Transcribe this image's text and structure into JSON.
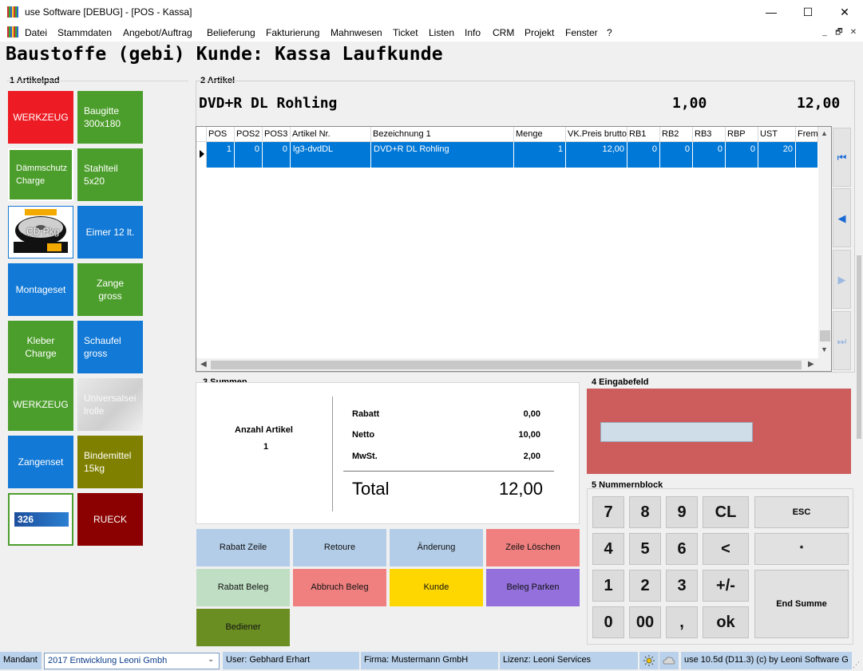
{
  "window": {
    "title": "use Software [DEBUG] - [POS - Kassa]",
    "min": "—",
    "max": "☐",
    "close": "✕"
  },
  "menu": [
    "Datei",
    "Stammdaten",
    "Angebot/Auftrag",
    "Belieferung",
    "Fakturierung",
    "Mahnwesen",
    "Ticket",
    "Listen",
    "Info",
    "CRM",
    "Projekt",
    "Fenster",
    "?"
  ],
  "mdi": [
    "_",
    "🗗",
    "✕"
  ],
  "header": {
    "title": "Baustoffe (gebi) Kunde: Kassa Laufkunde"
  },
  "artikelpad": {
    "label": "1 Artikelpad",
    "tiles": [
      {
        "label": "WERKZEUG",
        "color": "#ed1c24"
      },
      {
        "label": "Baugitte 300x180",
        "color": "#4c9e2c"
      },
      {
        "label": "Dämmschutz Charge",
        "color": "#4c9e2c"
      },
      {
        "label": "Stahlteil 5x20",
        "color": "#4c9e2c"
      },
      {
        "label": "CD Pkg",
        "color": "#ffffff"
      },
      {
        "label": "Eimer 12 lt.",
        "color": "#1279d6"
      },
      {
        "label": "Montageset",
        "color": "#1279d6"
      },
      {
        "label": "Zange gross",
        "color": "#4c9e2c"
      },
      {
        "label": "Kleber Charge",
        "color": "#4c9e2c"
      },
      {
        "label": "Schaufel gross",
        "color": "#1279d6"
      },
      {
        "label": "WERKZEUG",
        "color": "#4c9e2c"
      },
      {
        "label": "Universalseilrolle",
        "color": "#d7d7d7"
      },
      {
        "label": "Zangenset",
        "color": "#1279d6"
      },
      {
        "label": "Bindemittel 15kg",
        "color": "#808000"
      },
      {
        "label": "326",
        "color": "#ffffff"
      },
      {
        "label": "RUECK",
        "color": "#8b0000"
      }
    ]
  },
  "artikel": {
    "label": "2 Artikel",
    "name": "DVD+R DL Rohling",
    "qty": "1,00",
    "price": "12,00",
    "columns": [
      "POS",
      "POS2",
      "POS3",
      "Artikel Nr.",
      "Bezeichnung 1",
      "Menge",
      "VK.Preis brutto",
      "RB1",
      "RB2",
      "RB3",
      "RBP",
      "UST",
      "Frem"
    ],
    "rows": [
      [
        "1",
        "0",
        "0",
        "lg3-dvdDL",
        "DVD+R DL Rohling",
        "1",
        "12,00",
        "0",
        "0",
        "0",
        "0",
        "20",
        ""
      ]
    ],
    "nav": [
      "⏮",
      "◀",
      "▶",
      "⏭"
    ]
  },
  "summen": {
    "label": "3 Summen",
    "anzahl_label": "Anzahl Artikel",
    "anzahl_value": "1",
    "rabatt_label": "Rabatt",
    "rabatt_value": "0,00",
    "netto_label": "Netto",
    "netto_value": "10,00",
    "mwst_label": "MwSt.",
    "mwst_value": "2,00",
    "total_label": "Total",
    "total_value": "12,00"
  },
  "eingabe": {
    "label": "4 Eingabefeld",
    "value": ""
  },
  "nummernblock": {
    "label": "5 Nummernblock",
    "keys": [
      "7",
      "8",
      "9",
      "CL",
      "4",
      "5",
      "6",
      "<",
      "1",
      "2",
      "3",
      "+/-",
      "0",
      "00",
      ",",
      "ok"
    ],
    "esc": "ESC",
    "star": "*",
    "end": "End Summe"
  },
  "actions": [
    {
      "label": "Rabatt Zeile",
      "color": "#b3cde8"
    },
    {
      "label": "Retoure",
      "color": "#b3cde8"
    },
    {
      "label": "Änderung",
      "color": "#b3cde8"
    },
    {
      "label": "Zeile Löschen",
      "color": "#f08080"
    },
    {
      "label": "Rabatt Beleg",
      "color": "#bfdec3"
    },
    {
      "label": "Abbruch Beleg",
      "color": "#f08080"
    },
    {
      "label": "Kunde",
      "color": "#ffd700"
    },
    {
      "label": "Beleg Parken",
      "color": "#9370db"
    },
    {
      "label": "Bediener",
      "color": "#6b8e23"
    }
  ],
  "status": {
    "mandant_label": "Mandant",
    "mandant_value": "2017  Entwicklung Leoni Gmbh",
    "user": "User: Gebhard Erhart",
    "firma": "Firma: Mustermann GmbH",
    "lizenz": "Lizenz: Leoni Services",
    "version": "use 10.5d (D11.3) (c) by Leoni Software G"
  }
}
